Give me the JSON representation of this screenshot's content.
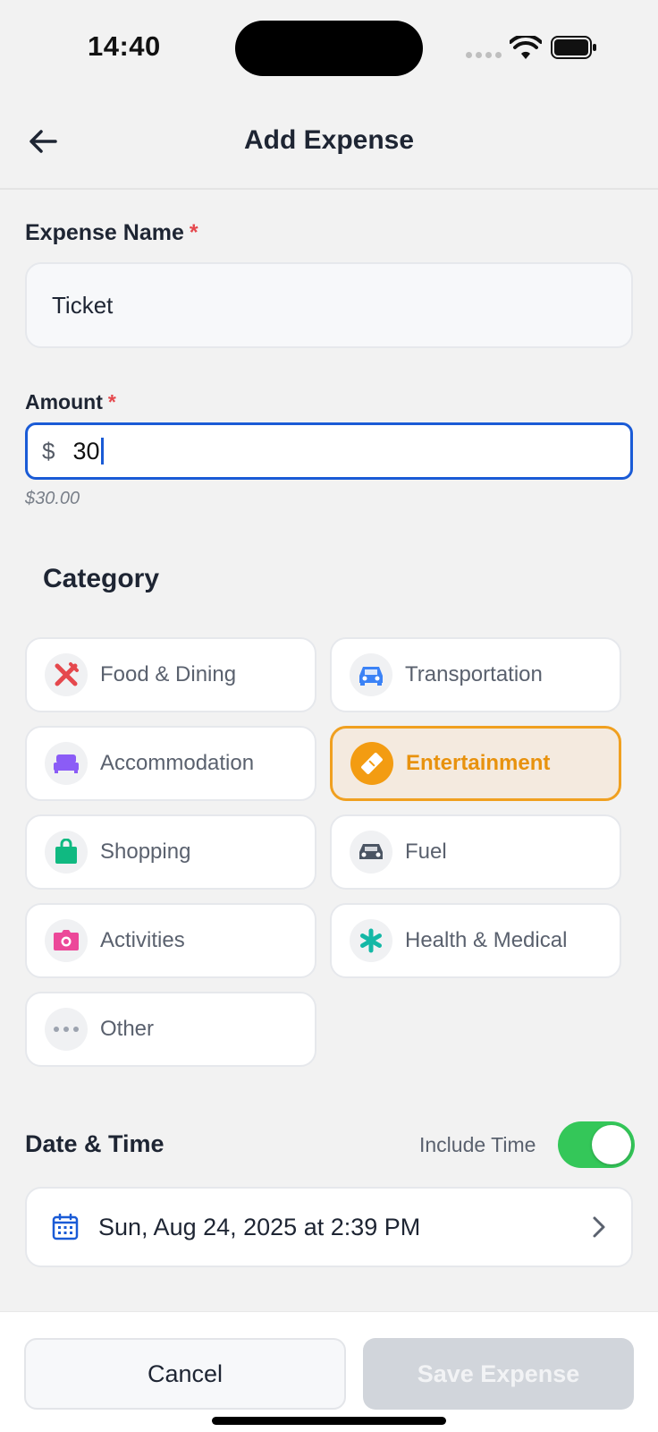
{
  "status_bar": {
    "time": "14:40"
  },
  "header": {
    "title": "Add Expense"
  },
  "form": {
    "name_label": "Expense Name",
    "required_mark": "*",
    "name_value": "Ticket",
    "amount_label": "Amount",
    "currency_symbol": "$",
    "amount_value": "30",
    "amount_formatted": "$30.00"
  },
  "category": {
    "title": "Category",
    "selected": "Entertainment",
    "items": [
      {
        "label": "Food & Dining",
        "icon": "utensils-icon",
        "color": "#e5484d"
      },
      {
        "label": "Transportation",
        "icon": "car-icon",
        "color": "#3b82f6"
      },
      {
        "label": "Accommodation",
        "icon": "bed-icon",
        "color": "#8b5cf6"
      },
      {
        "label": "Entertainment",
        "icon": "ticket-icon",
        "color": "#f39c12"
      },
      {
        "label": "Shopping",
        "icon": "shopping-bag-icon",
        "color": "#10b981"
      },
      {
        "label": "Fuel",
        "icon": "car-fuel-icon",
        "color": "#4b5563"
      },
      {
        "label": "Activities",
        "icon": "camera-icon",
        "color": "#ec4899"
      },
      {
        "label": "Health & Medical",
        "icon": "medical-asterisk-icon",
        "color": "#14b8a6"
      },
      {
        "label": "Other",
        "icon": "more-dots-icon",
        "color": "#9ca3af"
      }
    ]
  },
  "datetime": {
    "title": "Date & Time",
    "include_time_label": "Include Time",
    "include_time_on": true,
    "value": "Sun, Aug 24, 2025 at 2:39 PM"
  },
  "footer": {
    "cancel_label": "Cancel",
    "save_label": "Save Expense"
  },
  "colors": {
    "accent": "#1a5bd6",
    "selected_border": "#f0a020",
    "toggle_on": "#34c759",
    "disabled_button": "#d1d5db",
    "required": "#e5484d"
  }
}
